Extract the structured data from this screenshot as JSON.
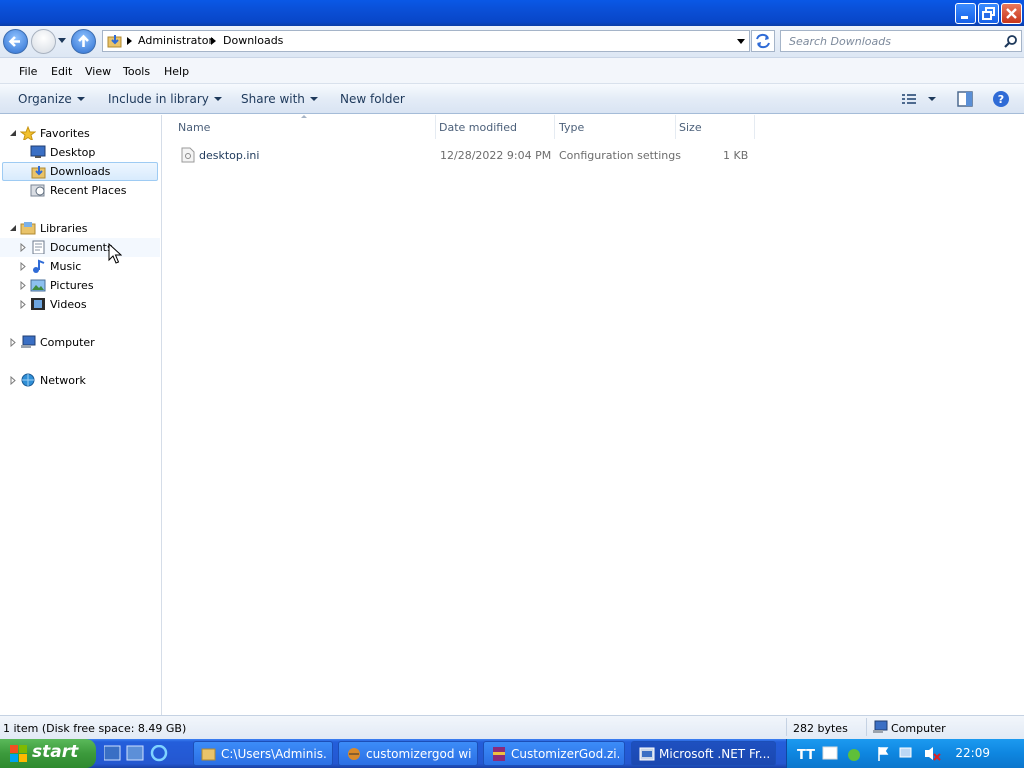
{
  "window": {
    "minimize": "minimize",
    "maximize": "restore",
    "close": "close"
  },
  "address": {
    "segments": [
      "Administrator",
      "Downloads"
    ]
  },
  "search": {
    "placeholder": "Search Downloads"
  },
  "menu": {
    "file": "File",
    "edit": "Edit",
    "view": "View",
    "tools": "Tools",
    "help": "Help"
  },
  "toolbar": {
    "organize": "Organize",
    "include": "Include in library",
    "share": "Share with",
    "newfolder": "New folder"
  },
  "sidebar": {
    "favorites": "Favorites",
    "desktop": "Desktop",
    "downloads": "Downloads",
    "recent": "Recent Places",
    "libraries": "Libraries",
    "documents": "Documents",
    "music": "Music",
    "pictures": "Pictures",
    "videos": "Videos",
    "computer": "Computer",
    "network": "Network"
  },
  "columns": {
    "name": "Name",
    "date": "Date modified",
    "type": "Type",
    "size": "Size"
  },
  "files": [
    {
      "name": "desktop.ini",
      "date": "12/28/2022 9:04 PM",
      "type": "Configuration settings",
      "size": "1 KB"
    }
  ],
  "status": {
    "items": "1 item (Disk free space: 8.49 GB)",
    "bytes": "282 bytes",
    "computer": "Computer"
  },
  "taskbar": {
    "start": "start",
    "tasks": [
      "C:\\Users\\Adminis...",
      "customizergod wi...",
      "CustomizerGod.zi...",
      "Microsoft .NET Fr..."
    ],
    "clock": "22:09"
  }
}
